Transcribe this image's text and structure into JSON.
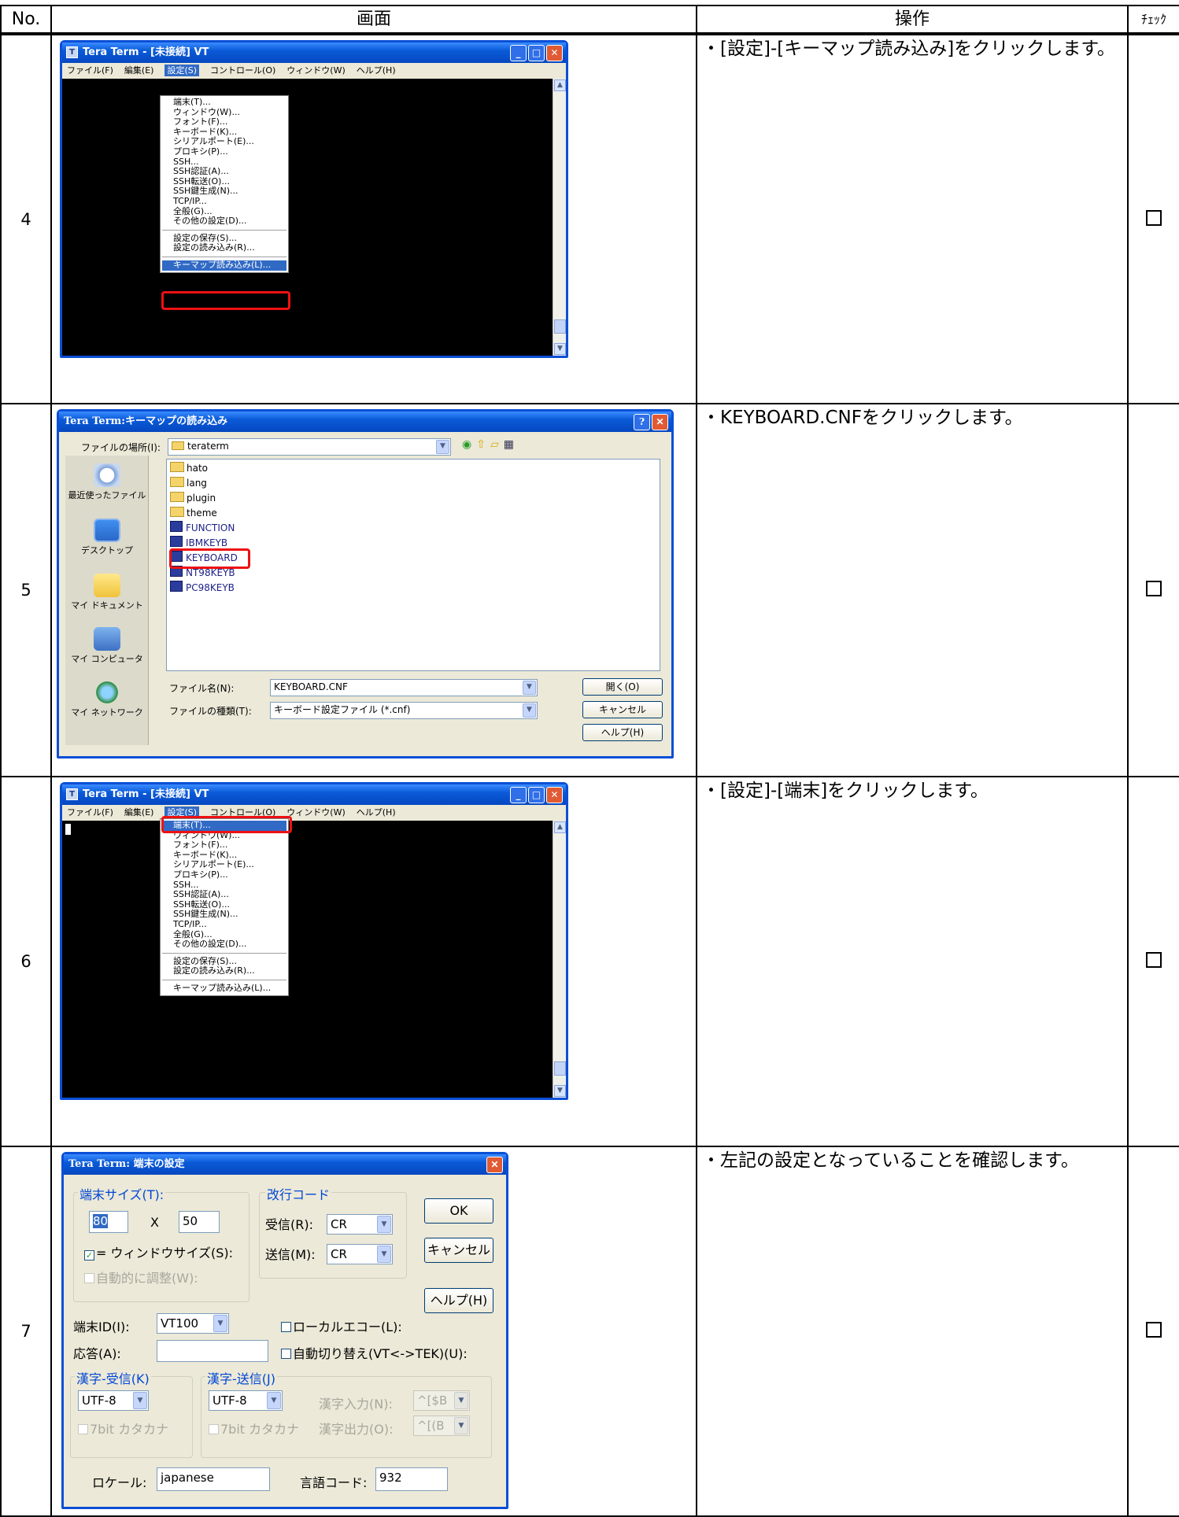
{
  "headers": {
    "no": "No.",
    "screen": "画面",
    "operation": "操作",
    "check": "ﾁｪｯｸ"
  },
  "rows": [
    {
      "no": "4",
      "operation": "・[設定]-[キーマップ読み込み]をクリックします。",
      "check": "☐"
    },
    {
      "no": "5",
      "operation": "・KEYBOARD.CNFをクリックします。",
      "check": "☐"
    },
    {
      "no": "6",
      "operation": "・[設定]-[端末]をクリックします。",
      "check": "☐"
    },
    {
      "no": "7",
      "operation": "・左記の設定となっていることを確認します。",
      "check": "☐"
    }
  ],
  "teraterm_window": {
    "title": "Tera Term - [未接続] VT",
    "menubar": [
      "ファイル(F)",
      "編集(E)",
      "設定(S)",
      "コントロール(O)",
      "ウィンドウ(W)",
      "ヘルプ(H)"
    ],
    "settings_menu_group1": [
      "端末(T)...",
      "ウィンドウ(W)...",
      "フォント(F)...",
      "キーボード(K)...",
      "シリアルポート(E)...",
      "プロキシ(P)...",
      "SSH...",
      "SSH認証(A)...",
      "SSH転送(O)...",
      "SSH鍵生成(N)...",
      "TCP/IP...",
      "全般(G)...",
      "その他の設定(D)..."
    ],
    "settings_menu_group2": [
      "設定の保存(S)...",
      "設定の読み込み(R)..."
    ],
    "settings_menu_group3": [
      "キーマップ読み込み(L)..."
    ]
  },
  "keymap_dialog": {
    "title": "Tera Term:キーマップの読み込み",
    "lookin_label": "ファイルの場所(I):",
    "lookin_value": "teraterm",
    "places": [
      "最近使ったファイル",
      "デスクトップ",
      "マイ ドキュメント",
      "マイ コンピュータ",
      "マイ ネットワーク"
    ],
    "folders": [
      "hato",
      "lang",
      "plugin",
      "theme"
    ],
    "files": [
      "FUNCTION",
      "IBMKEYB",
      "KEYBOARD",
      "NT98KEYB",
      "PC98KEYB"
    ],
    "filename_label": "ファイル名(N):",
    "filename_value": "KEYBOARD.CNF",
    "filetype_label": "ファイルの種類(T):",
    "filetype_value": "キーボード設定ファイル (*.cnf)",
    "open_button": "開く(O)",
    "cancel_button": "キャンセル",
    "help_button": "ヘルプ(H)"
  },
  "terminal_dialog": {
    "title": "Tera Term: 端末の設定",
    "size_group": "端末サイズ(T):",
    "cols": "80",
    "x": "X",
    "rows": "50",
    "window_size_check": "= ウィンドウサイズ(S):",
    "auto_adjust": "自動的に調整(W):",
    "newline_group": "改行コード",
    "receive_label": "受信(R):",
    "receive_value": "CR",
    "send_label": "送信(M):",
    "send_value": "CR",
    "ok": "OK",
    "cancel": "キャンセル",
    "help": "ヘルプ(H)",
    "term_id_label": "端末ID(I):",
    "term_id_value": "VT100",
    "local_echo": "ローカルエコー(L):",
    "answer_label": "応答(A):",
    "answer_value": "",
    "auto_switch": "自動切り替え(VT<->TEK)(U):",
    "kanji_recv_group": "漢字-受信(K)",
    "kanji_recv_value": "UTF-8",
    "kanji_send_group": "漢字-送信(J)",
    "kanji_send_value": "UTF-8",
    "katakana_recv": "7bit カタカナ",
    "katakana_send": "7bit カタカナ",
    "kanji_in_label": "漢字入力(N):",
    "kanji_in_value": "^[$B",
    "kanji_out_label": "漢字出力(O):",
    "kanji_out_value": "^[(B",
    "locale_label": "ロケール:",
    "locale_value": "japanese",
    "langcode_label": "言語コード:",
    "langcode_value": "932"
  }
}
